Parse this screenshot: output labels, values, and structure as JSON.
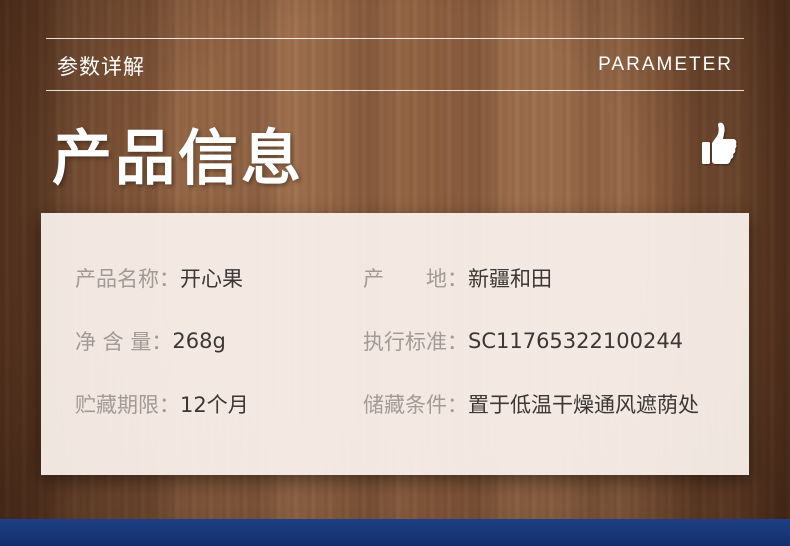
{
  "header": {
    "subtitle_cn": "参数详解",
    "subtitle_en": "PARAMETER",
    "title": "产品信息",
    "icon": "thumbs-up-icon"
  },
  "params": {
    "name_label": "产品名称",
    "name_value": "开心果",
    "origin_label": "产　　地",
    "origin_value": "新疆和田",
    "netweight_label": "净 含 量",
    "netweight_value": "268g",
    "standard_label": "执行标准",
    "standard_value": "SC11765322100244",
    "shelf_label": "贮藏期限",
    "shelf_value": "12个月",
    "storage_label": "储藏条件",
    "storage_value": "置于低温干燥通风遮荫处",
    "colon": "："
  },
  "colors": {
    "footer_band": "#1e3f86",
    "label": "#a39a95",
    "value": "#3c3634"
  }
}
